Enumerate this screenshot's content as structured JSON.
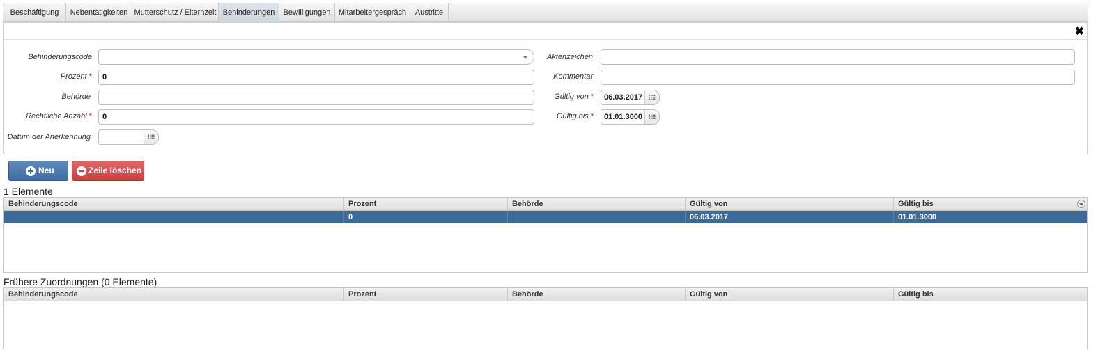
{
  "tabs": [
    {
      "label": "Beschäftigung"
    },
    {
      "label": "Nebentätigkeiten"
    },
    {
      "label": "Mutterschutz / Elternzeit"
    },
    {
      "label": "Behinderungen"
    },
    {
      "label": "Bewilligungen"
    },
    {
      "label": "Mitarbeitergespräch"
    },
    {
      "label": "Austritte"
    }
  ],
  "active_tab": "Behinderungen",
  "form": {
    "behinderungscode": {
      "label": "Behinderungscode",
      "value": ""
    },
    "prozent": {
      "label": "Prozent",
      "value": "0",
      "required_mark": "*"
    },
    "behoerde": {
      "label": "Behörde",
      "value": ""
    },
    "rechtliche_anzahl": {
      "label": "Rechtliche Anzahl",
      "value": "0",
      "required_mark": "*"
    },
    "datum_anerkennung": {
      "label": "Datum der Anerkennung",
      "value": ""
    },
    "aktenzeichen": {
      "label": "Aktenzeichen",
      "value": ""
    },
    "kommentar": {
      "label": "Kommentar",
      "value": ""
    },
    "gueltig_von": {
      "label": "Gültig von",
      "value": "06.03.2017",
      "required_mark": "*"
    },
    "gueltig_bis": {
      "label": "Gültig bis",
      "value": "01.01.3000",
      "required_mark": "*"
    }
  },
  "buttons": {
    "neu": "Neu",
    "zeile_loeschen": "Zeile löschen"
  },
  "current_grid": {
    "title": "1 Elemente",
    "columns": [
      "Behinderungscode",
      "Prozent",
      "Behörde",
      "Gültig von",
      "Gültig bis"
    ],
    "rows": [
      {
        "behinderungscode": "",
        "prozent": "0",
        "behoerde": "",
        "gueltig_von": "06.03.2017",
        "gueltig_bis": "01.01.3000"
      }
    ]
  },
  "previous_grid": {
    "title": "Frühere Zuordnungen (0 Elemente)",
    "columns": [
      "Behinderungscode",
      "Prozent",
      "Behörde",
      "Gültig von",
      "Gültig bis"
    ]
  },
  "colors": {
    "accent_blue": "#3e6a9a",
    "danger_red": "#c94141",
    "required": "#dd0000"
  }
}
